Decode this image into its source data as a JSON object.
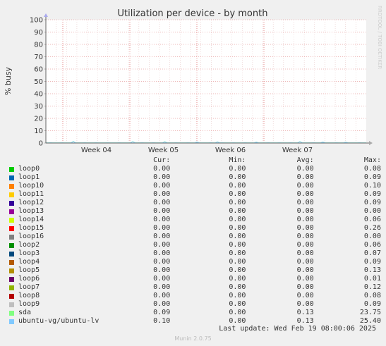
{
  "chart_data": {
    "type": "line",
    "title": "Utilization per device - by month",
    "ylabel": "% busy",
    "ylim": [
      0,
      100
    ],
    "yticks": [
      0,
      10,
      20,
      30,
      40,
      50,
      60,
      70,
      80,
      90,
      100
    ],
    "xticks": [
      "Week 04",
      "Week 05",
      "Week 06",
      "Week 07"
    ],
    "grid": true,
    "watermark": "RRDTOOL / TOBI OETIKER",
    "columns": [
      "Cur:",
      "Min:",
      "Avg:",
      "Max:"
    ],
    "series": [
      {
        "name": "loop0",
        "color": "#00cc00",
        "cur": "0.00",
        "min": "0.00",
        "avg": "0.00",
        "max": "0.08"
      },
      {
        "name": "loop1",
        "color": "#0066b3",
        "cur": "0.00",
        "min": "0.00",
        "avg": "0.00",
        "max": "0.09"
      },
      {
        "name": "loop10",
        "color": "#ff8000",
        "cur": "0.00",
        "min": "0.00",
        "avg": "0.00",
        "max": "0.10"
      },
      {
        "name": "loop11",
        "color": "#ffcc00",
        "cur": "0.00",
        "min": "0.00",
        "avg": "0.00",
        "max": "0.09"
      },
      {
        "name": "loop12",
        "color": "#330099",
        "cur": "0.00",
        "min": "0.00",
        "avg": "0.00",
        "max": "0.09"
      },
      {
        "name": "loop13",
        "color": "#990099",
        "cur": "0.00",
        "min": "0.00",
        "avg": "0.00",
        "max": "0.00"
      },
      {
        "name": "loop14",
        "color": "#ccff00",
        "cur": "0.00",
        "min": "0.00",
        "avg": "0.00",
        "max": "0.06"
      },
      {
        "name": "loop15",
        "color": "#ff0000",
        "cur": "0.00",
        "min": "0.00",
        "avg": "0.00",
        "max": "0.26"
      },
      {
        "name": "loop16",
        "color": "#808080",
        "cur": "0.00",
        "min": "0.00",
        "avg": "0.00",
        "max": "0.00"
      },
      {
        "name": "loop2",
        "color": "#008f00",
        "cur": "0.00",
        "min": "0.00",
        "avg": "0.00",
        "max": "0.06"
      },
      {
        "name": "loop3",
        "color": "#00487d",
        "cur": "0.00",
        "min": "0.00",
        "avg": "0.00",
        "max": "0.07"
      },
      {
        "name": "loop4",
        "color": "#b35a00",
        "cur": "0.00",
        "min": "0.00",
        "avg": "0.00",
        "max": "0.09"
      },
      {
        "name": "loop5",
        "color": "#b38f00",
        "cur": "0.00",
        "min": "0.00",
        "avg": "0.00",
        "max": "0.13"
      },
      {
        "name": "loop6",
        "color": "#6b006b",
        "cur": "0.00",
        "min": "0.00",
        "avg": "0.00",
        "max": "0.01"
      },
      {
        "name": "loop7",
        "color": "#8fb300",
        "cur": "0.00",
        "min": "0.00",
        "avg": "0.00",
        "max": "0.12"
      },
      {
        "name": "loop8",
        "color": "#b30000",
        "cur": "0.00",
        "min": "0.00",
        "avg": "0.00",
        "max": "0.08"
      },
      {
        "name": "loop9",
        "color": "#bebebe",
        "cur": "0.00",
        "min": "0.00",
        "avg": "0.00",
        "max": "0.09"
      },
      {
        "name": "sda",
        "color": "#80ff80",
        "cur": "0.09",
        "min": "0.00",
        "avg": "0.13",
        "max": "23.75"
      },
      {
        "name": "ubuntu-vg/ubuntu-lv",
        "color": "#80c9ff",
        "cur": "0.10",
        "min": "0.00",
        "avg": "0.13",
        "max": "25.40"
      }
    ]
  },
  "footer": {
    "last_update": "Last update: Wed Feb 19 08:00:06 2025",
    "version": "Munin 2.0.75"
  }
}
